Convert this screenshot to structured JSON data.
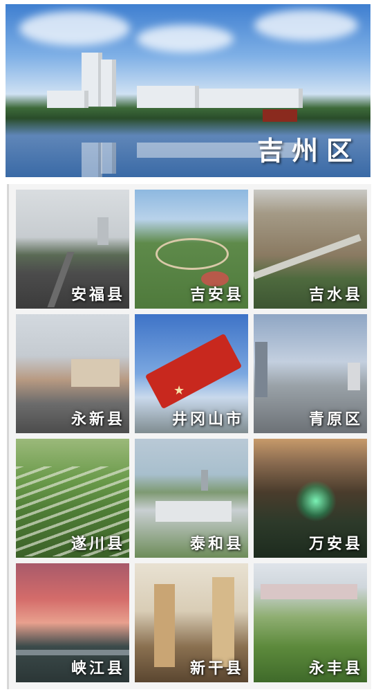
{
  "hero": {
    "title": "吉州区"
  },
  "tiles": [
    {
      "label": "安福县"
    },
    {
      "label": "吉安县"
    },
    {
      "label": "吉水县"
    },
    {
      "label": "永新县"
    },
    {
      "label": "井冈山市"
    },
    {
      "label": "青原区"
    },
    {
      "label": "遂川县"
    },
    {
      "label": "泰和县"
    },
    {
      "label": "万安县"
    },
    {
      "label": "峡江县"
    },
    {
      "label": "新干县"
    },
    {
      "label": "永丰县"
    }
  ]
}
